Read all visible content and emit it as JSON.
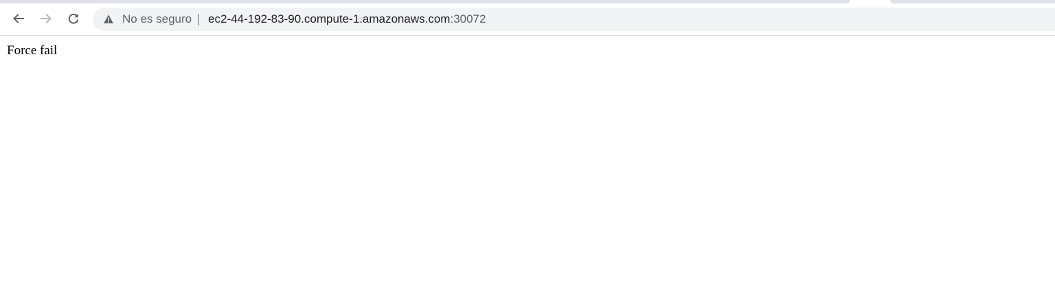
{
  "browser": {
    "security": {
      "label": "No es seguro",
      "icon": "warning-triangle-icon"
    },
    "url": {
      "host": "ec2-44-192-83-90.compute-1.amazonaws.com",
      "port": ":30072"
    },
    "nav": {
      "back_icon": "arrow-left-icon",
      "forward_icon": "arrow-right-icon",
      "reload_icon": "reload-icon"
    }
  },
  "page": {
    "body_text": "Force fail"
  },
  "colors": {
    "toolbar_bg": "#ffffff",
    "omnibox_bg": "#f1f3f4",
    "tab_inactive": "#dee1e6",
    "text_muted": "#5f6368",
    "text_primary": "#202124"
  }
}
